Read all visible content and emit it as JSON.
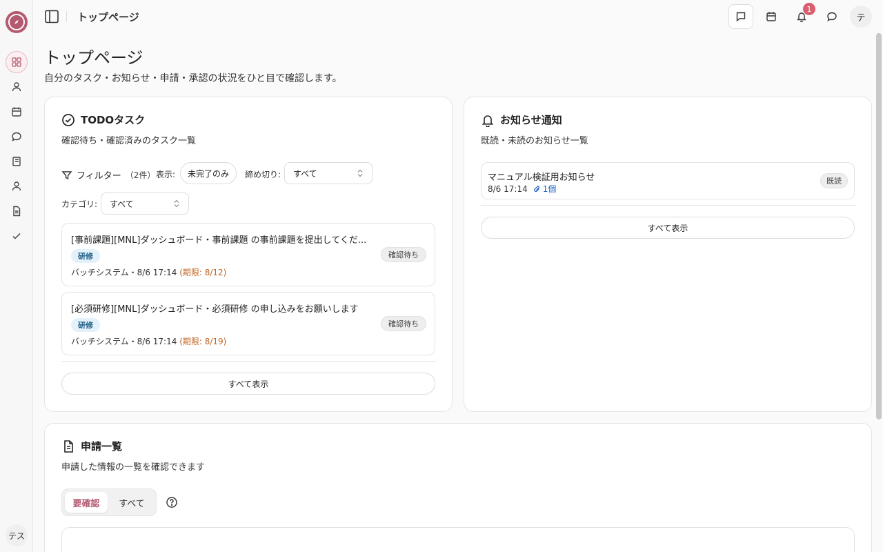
{
  "sidebar": {
    "items": [
      "dashboard-icon",
      "user-icon",
      "calendar-icon",
      "chat-icon",
      "book-icon",
      "person-icon",
      "document-icon",
      "check-icon"
    ],
    "user_label": "テス"
  },
  "header": {
    "breadcrumb": "トップページ",
    "notification_count": "1",
    "avatar_label": "テ"
  },
  "page": {
    "title": "トップページ",
    "description": "自分のタスク・お知らせ・申請・承認の状況をひと目で確認します。"
  },
  "todo": {
    "title": "TODOタスク",
    "description": "確認待ち・確認済みのタスク一覧",
    "filter_label": "フィルター",
    "filter_count": "（2件）",
    "display_label": "表示:",
    "display_value": "未完了のみ",
    "deadline_label": "締め切り:",
    "deadline_value": "すべて",
    "category_label": "カテゴリ:",
    "category_value": "すべて",
    "tasks": [
      {
        "title": "[事前課題][MNL]ダッシュボード・事前課題 の事前課題を提出してくだ...",
        "tag": "研修",
        "meta": "バッチシステム・8/6 17:14",
        "due": "(期限: 8/12)",
        "status": "確認待ち"
      },
      {
        "title": "[必須研修][MNL]ダッシュボード・必須研修 の申し込みをお願いします",
        "tag": "研修",
        "meta": "バッチシステム・8/6 17:14",
        "due": "(期限: 8/19)",
        "status": "確認待ち"
      }
    ],
    "show_all": "すべて表示"
  },
  "notices": {
    "title": "お知らせ通知",
    "description": "既読・未読のお知らせ一覧",
    "items": [
      {
        "title": "マニュアル検証用お知らせ",
        "time": "8/6 17:14",
        "attachment": "1個",
        "status": "既読"
      }
    ],
    "show_all": "すべて表示"
  },
  "applications": {
    "title": "申請一覧",
    "description": "申請した情報の一覧を確認できます",
    "tab_active": "要確認",
    "tab_all": "すべて"
  },
  "colors": {
    "accent": "#b4596f",
    "due": "#c0621e",
    "tag_bg": "#e3f1fb",
    "badge": "#d95f6e"
  }
}
